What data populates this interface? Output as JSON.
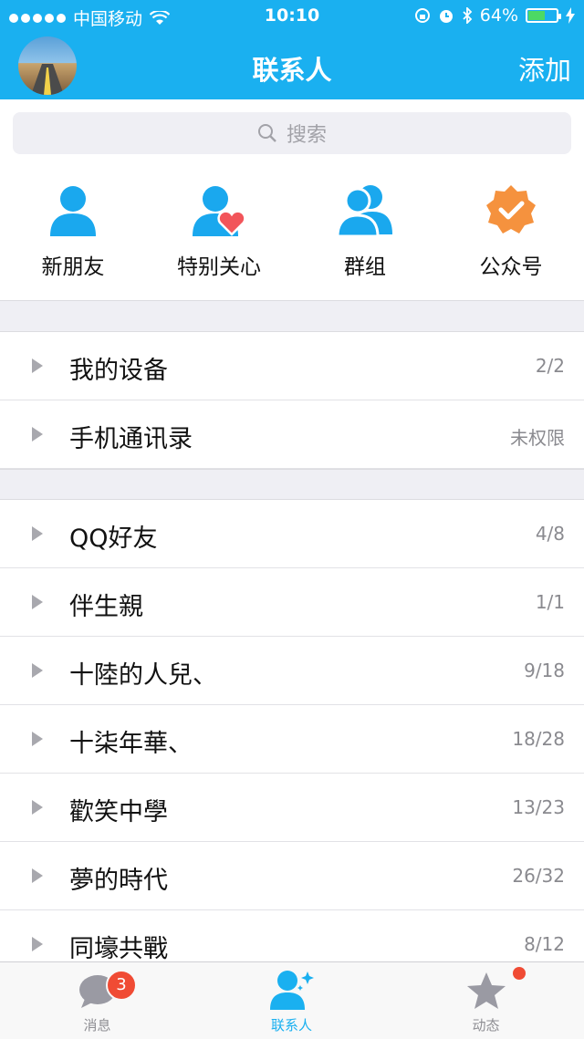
{
  "status": {
    "carrier": "中国移动",
    "time": "10:10",
    "battery": "64%",
    "battery_level": 0.64
  },
  "nav": {
    "title": "联系人",
    "add": "添加"
  },
  "search": {
    "placeholder": "搜索"
  },
  "quick": [
    {
      "label": "新朋友",
      "icon": "person-icon"
    },
    {
      "label": "特别关心",
      "icon": "person-heart-icon"
    },
    {
      "label": "群组",
      "icon": "group-icon"
    },
    {
      "label": "公众号",
      "icon": "verified-badge-icon"
    }
  ],
  "section1": [
    {
      "name": "我的设备",
      "count": "2/2"
    },
    {
      "name": "手机通讯录",
      "count": "未权限"
    }
  ],
  "groups": [
    {
      "name": "QQ好友",
      "count": "4/8"
    },
    {
      "name": "伴生親",
      "count": "1/1"
    },
    {
      "name": "十陸的人兒、",
      "count": "9/18"
    },
    {
      "name": "十柒年華、",
      "count": "18/28"
    },
    {
      "name": "歡笑中學",
      "count": "13/23"
    },
    {
      "name": "夢的時代",
      "count": "26/32"
    },
    {
      "name": "同壕共戰",
      "count": "8/12"
    }
  ],
  "tabs": [
    {
      "label": "消息",
      "badge": "3"
    },
    {
      "label": "联系人"
    },
    {
      "label": "动态"
    }
  ],
  "colors": {
    "brand": "#1ab0f0",
    "badge": "#f04b34",
    "heart": "#f2555a",
    "public": "#f5923e"
  }
}
